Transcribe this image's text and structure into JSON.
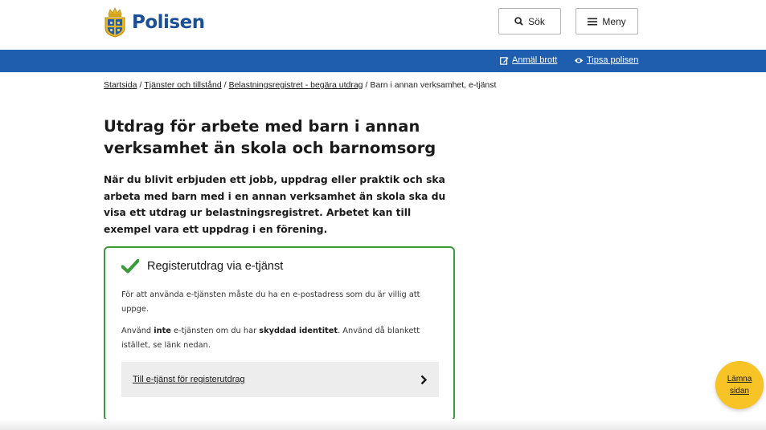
{
  "header": {
    "logo_text": "Polisen",
    "search_label": "Sök",
    "menu_label": "Meny"
  },
  "topbar": {
    "report_label": "Anmäl brott",
    "tip_label": "Tipsa polisen"
  },
  "breadcrumb": {
    "items": [
      "Startsida",
      "Tjänster och tillstånd",
      "Belastningsregistret - begära utdrag"
    ],
    "current": "Barn i annan verksamhet, e-tjänst",
    "separator": "/"
  },
  "page": {
    "title": "Utdrag för arbete med barn i annan verksamhet än skola och barnomsorg",
    "lead": "När du blivit erbjuden ett jobb, uppdrag eller praktik och ska arbeta med barn med i en annan verksamhet än skola ska du visa ett utdrag ur belastningsregistret. Arbetet kan till exempel vara ett uppdrag i en förening."
  },
  "card": {
    "title": "Registerutdrag via e-tjänst",
    "p1": "För att använda e-tjänsten måste du ha en e-postadress som du är villig att uppge.",
    "p2_before": "Använd ",
    "p2_bold1": "inte",
    "p2_middle": " e-tjänsten om du har ",
    "p2_bold2": "skyddad identitet",
    "p2_after": ". Använd då blankett istället, se länk nedan.",
    "link_label": "Till e-tjänst för registerutdrag"
  },
  "leave_button": {
    "line1": "Lämna",
    "line2": "sidan"
  },
  "colors": {
    "brand_blue": "#1f5eae",
    "logo_blue": "#1b4f96",
    "success_green": "#3a9b3a",
    "leave_yellow": "#f7c325"
  }
}
